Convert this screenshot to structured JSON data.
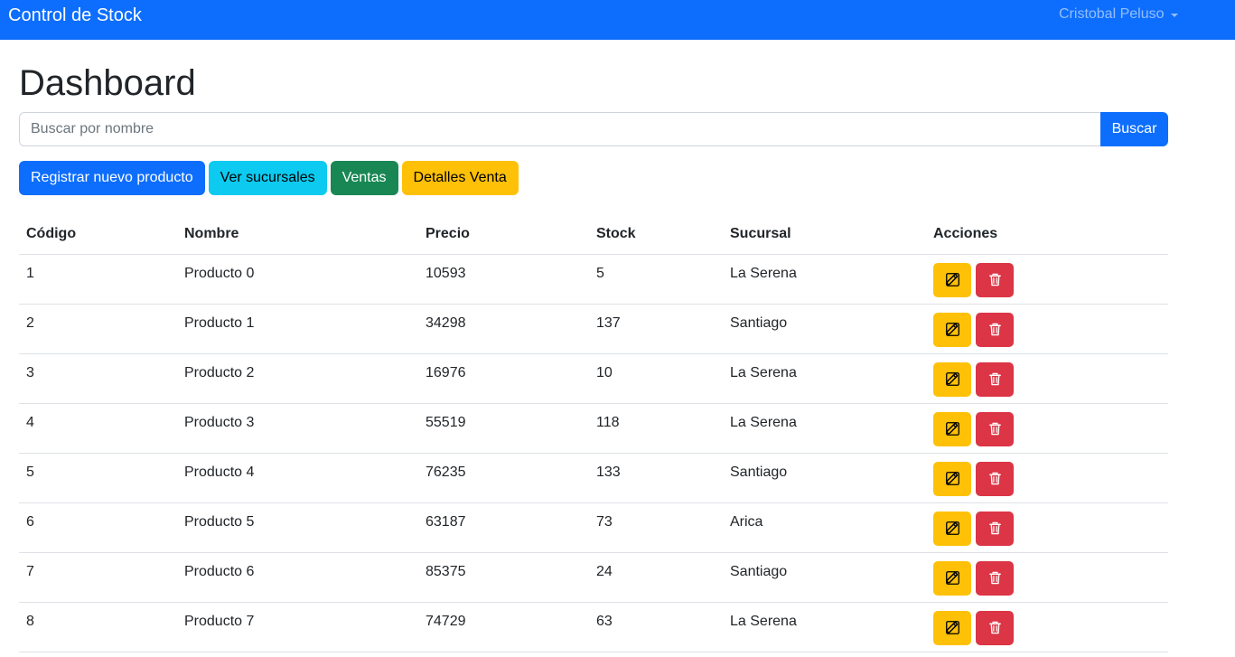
{
  "navbar": {
    "brand": "Control de Stock",
    "user": "Cristobal Peluso"
  },
  "page": {
    "title": "Dashboard"
  },
  "search": {
    "placeholder": "Buscar por nombre",
    "value": "",
    "button": "Buscar"
  },
  "actions": {
    "register": "Registrar nuevo producto",
    "branches": "Ver sucursales",
    "sales": "Ventas",
    "sale_details": "Detalles Venta"
  },
  "table": {
    "headers": [
      "Código",
      "Nombre",
      "Precio",
      "Stock",
      "Sucursal",
      "Acciones"
    ],
    "rows": [
      [
        "1",
        "Producto 0",
        "10593",
        "5",
        "La Serena"
      ],
      [
        "2",
        "Producto 1",
        "34298",
        "137",
        "Santiago"
      ],
      [
        "3",
        "Producto 2",
        "16976",
        "10",
        "La Serena"
      ],
      [
        "4",
        "Producto 3",
        "55519",
        "118",
        "La Serena"
      ],
      [
        "5",
        "Producto 4",
        "76235",
        "133",
        "Santiago"
      ],
      [
        "6",
        "Producto 5",
        "63187",
        "73",
        "Arica"
      ],
      [
        "7",
        "Producto 6",
        "85375",
        "24",
        "Santiago"
      ],
      [
        "8",
        "Producto 7",
        "74729",
        "63",
        "La Serena"
      ]
    ],
    "row_actions": {
      "edit_icon": "edit-icon",
      "delete_icon": "trash-icon"
    }
  },
  "colors": {
    "primary": "#0d6efd",
    "info": "#0dcaf0",
    "success": "#198754",
    "warning": "#ffc107",
    "danger": "#dc3545"
  }
}
